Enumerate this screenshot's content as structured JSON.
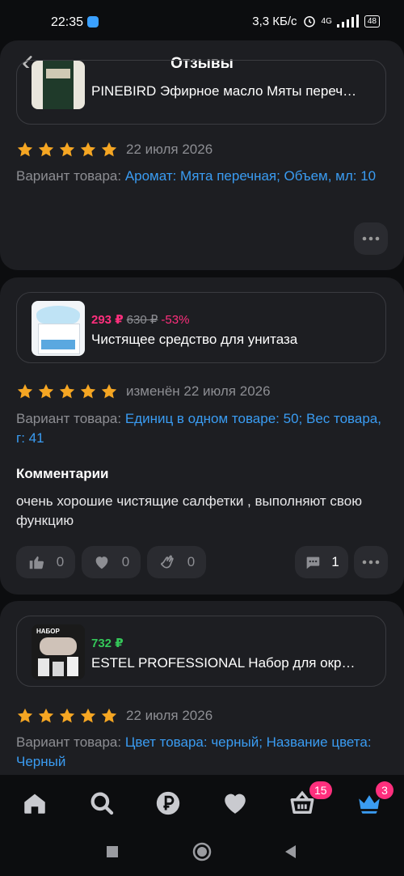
{
  "status": {
    "time": "22:35",
    "speed": "3,3 КБ/с",
    "network": "4G",
    "battery": "48"
  },
  "header": {
    "title": "Отзывы"
  },
  "reviews": [
    {
      "product_name": "PINEBIRD Эфирное масло Мяты переч…",
      "rating": 5,
      "date": "22 июля 2026",
      "variant_label": "Вариант товара:",
      "variant_value": "Аромат: Мята перечная; Объем, мл: 10"
    },
    {
      "price": "293 ₽",
      "old_price": "630 ₽",
      "discount": "-53%",
      "product_name": "Чистящее средство для унитаза",
      "rating": 5,
      "date": "изменён 22 июля 2026",
      "variant_label": "Вариант товара:",
      "variant_value": "Единиц в одном товаре: 50; Вес товара, г: 41",
      "comments_title": "Комментарии",
      "comment": "очень хорошие чистящие салфетки , выполняют свою функцию",
      "likes": "0",
      "hearts": "0",
      "claps": "0",
      "replies": "1"
    },
    {
      "price": "732 ₽",
      "product_name": "ESTEL PROFESSIONAL Набор для окр…",
      "image_caption": "НАБОР",
      "rating": 5,
      "date": "22 июля 2026",
      "variant_label": "Вариант товара:",
      "variant_value": "Цвет товара: черный; Название цвета: Черный"
    }
  ],
  "nav": {
    "cart_badge": "15",
    "profile_badge": "3"
  },
  "colors": {
    "accent": "#3a9cf2",
    "price_pink": "#ff2f7d",
    "price_green": "#34c759",
    "star": "#f5a623"
  }
}
